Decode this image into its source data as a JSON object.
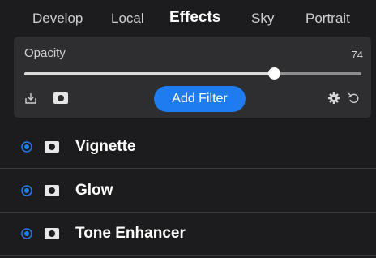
{
  "tabs": [
    {
      "label": "Develop",
      "active": false
    },
    {
      "label": "Local",
      "active": false
    },
    {
      "label": "Effects",
      "active": true
    },
    {
      "label": "Sky",
      "active": false
    },
    {
      "label": "Portrait",
      "active": false
    }
  ],
  "opacity": {
    "label": "Opacity",
    "value": "74",
    "level_fraction": 0.74
  },
  "toolbar": {
    "left_icons": [
      "export-icon",
      "mask-icon"
    ],
    "add_filter_label": "Add Filter",
    "right_icons": [
      "gear-icon",
      "undo-icon"
    ]
  },
  "filters": [
    {
      "name": "Vignette",
      "enabled": true
    },
    {
      "name": "Glow",
      "enabled": true
    },
    {
      "name": "Tone Enhancer",
      "enabled": true
    }
  ],
  "colors": {
    "background": "#1c1c1e",
    "panel": "#2e2e30",
    "accent": "#1e7cf0",
    "text": "#ffffff"
  }
}
